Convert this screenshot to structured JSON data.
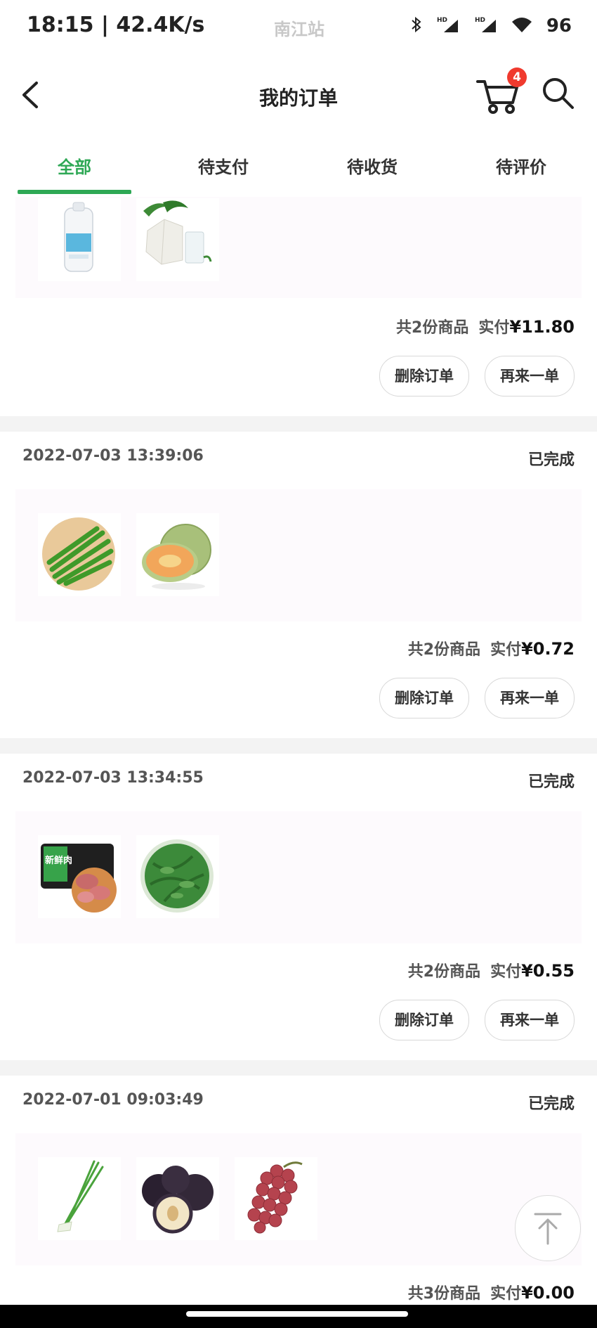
{
  "status_bar": {
    "time": "18:15 | 42.4K/s",
    "station": "南江站",
    "battery": "96"
  },
  "header": {
    "title": "我的订单",
    "cart_count": "4"
  },
  "tabs": [
    {
      "label": "全部"
    },
    {
      "label": "待支付"
    },
    {
      "label": "待收货"
    },
    {
      "label": "待评价"
    }
  ],
  "orders": [
    {
      "date": "",
      "status": "",
      "items": [
        "milk-jug",
        "coconut"
      ],
      "count_text": "共2份商品",
      "paid_label": "实付",
      "price": "¥11.80",
      "delete_label": "删除订单",
      "reorder_label": "再来一单"
    },
    {
      "date": "2022-07-03 13:39:06",
      "status": "已完成",
      "items": [
        "green-beans",
        "melon"
      ],
      "count_text": "共2份商品",
      "paid_label": "实付",
      "price": "¥0.72",
      "delete_label": "删除订单",
      "reorder_label": "再来一单"
    },
    {
      "date": "2022-07-03 13:34:55",
      "status": "已完成",
      "items": [
        "fresh-meat",
        "kelp"
      ],
      "count_text": "共2份商品",
      "paid_label": "实付",
      "price": "¥0.55",
      "delete_label": "删除订单",
      "reorder_label": "再来一单"
    },
    {
      "date": "2022-07-01 09:03:49",
      "status": "已完成",
      "items": [
        "scallion",
        "plums",
        "grapes"
      ],
      "count_text": "共3份商品",
      "paid_label": "实付",
      "price": "¥0.00"
    }
  ],
  "thumb_labels": {
    "meat_label": "新鲜肉"
  },
  "colors": {
    "accent": "#2ea855",
    "badge": "#f03a2e",
    "panel": "#fdfafd",
    "divider": "#f3f3f3"
  }
}
